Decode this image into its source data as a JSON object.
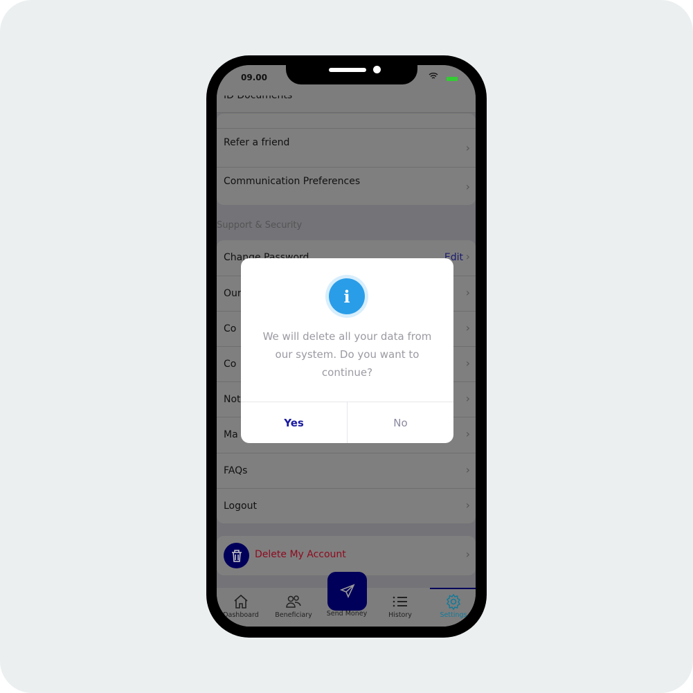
{
  "status": {
    "time": "09.00"
  },
  "profile_rows": [
    {
      "label": "ID Documents"
    },
    {
      "label": "Refer a friend"
    },
    {
      "label": "Communication Preferences"
    }
  ],
  "section_title": "Support & Security",
  "support_rows": [
    {
      "label": "Change Password",
      "action": "Edit"
    },
    {
      "label": "Our"
    },
    {
      "label": "Co"
    },
    {
      "label": "Co"
    },
    {
      "label": "Not"
    },
    {
      "label": "Ma"
    },
    {
      "label": "FAQs"
    },
    {
      "label": "Logout"
    }
  ],
  "delete_account": {
    "label": "Delete My Account",
    "color": "#c8102e"
  },
  "nav": [
    {
      "label": "Dashboard",
      "icon": "home-icon"
    },
    {
      "label": "Beneficiary",
      "icon": "users-icon"
    },
    {
      "label": "Send Money",
      "icon": "send-icon"
    },
    {
      "label": "History",
      "icon": "list-icon"
    },
    {
      "label": "Settings",
      "icon": "gear-icon",
      "active": true
    }
  ],
  "dialog": {
    "icon": "info-icon",
    "message": "We will delete all your data from our system. Do you want to continue?",
    "yes": "Yes",
    "no": "No"
  },
  "colors": {
    "accent": "#00005a",
    "active_tab": "#1aa0c8"
  }
}
